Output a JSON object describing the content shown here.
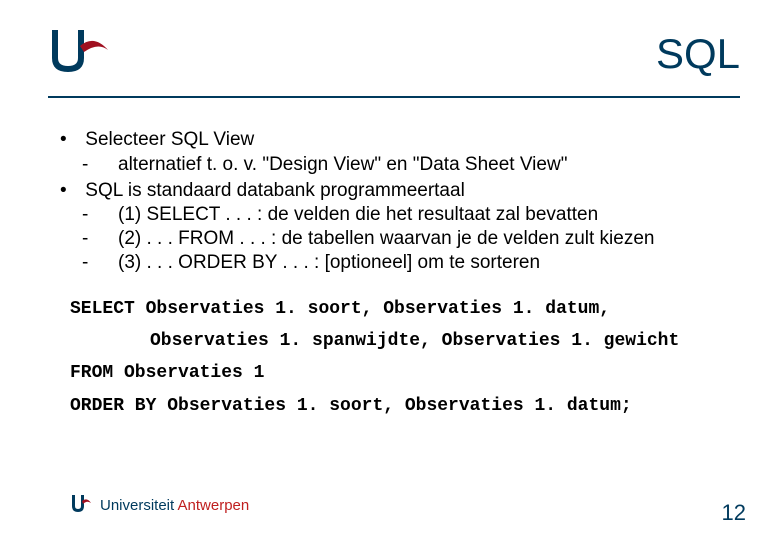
{
  "title": "SQL",
  "bullets": {
    "b1": {
      "text": "Selecteer SQL View",
      "sub": [
        "alternatief t. o. v. \"Design View\" en \"Data Sheet View\""
      ]
    },
    "b2": {
      "text": "SQL is standaard databank programmeertaal",
      "sub": [
        "(1) SELECT . . . : de velden die het resultaat zal bevatten",
        "(2) . . . FROM . . . : de tabellen waarvan je de velden zult kiezen",
        "(3) . . . ORDER BY . . . : [optioneel] om te sorteren"
      ]
    }
  },
  "code": {
    "l1": "SELECT Observaties 1. soort, Observaties 1. datum,",
    "l2": "Observaties 1. spanwijdte, Observaties 1. gewicht",
    "l3": "FROM Observaties 1",
    "l4": "ORDER BY Observaties 1. soort, Observaties 1. datum;"
  },
  "footer": {
    "uni": "Universiteit",
    "ant": "Antwerpen"
  },
  "page_number": "12"
}
